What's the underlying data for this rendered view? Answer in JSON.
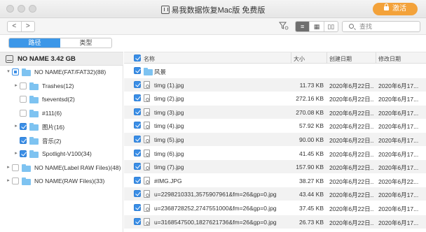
{
  "window": {
    "title": "易我数据恢复Mac版 免费版",
    "activate_label": "激活"
  },
  "toolbar": {
    "back": "<",
    "forward": ">",
    "filter_icon": "filter-icon",
    "view_modes": [
      "≡",
      "▦",
      "▯▯"
    ],
    "search_placeholder": "查找"
  },
  "left_tabs": {
    "path_label": "路径",
    "type_label": "类型",
    "selected": "路径"
  },
  "drive": {
    "label": "NO NAME 3.42 GB"
  },
  "tree": [
    {
      "label": "NO NAME(FAT/FAT32)(88)",
      "state": "mixed",
      "arrow": "▾",
      "depth": 0
    },
    {
      "label": "Trashes(12)",
      "state": "unchecked",
      "arrow": "▸",
      "depth": 1
    },
    {
      "label": "fseventsd(2)",
      "state": "unchecked",
      "arrow": "",
      "depth": 1
    },
    {
      "label": "#111(6)",
      "state": "unchecked",
      "arrow": "",
      "depth": 1
    },
    {
      "label": "图片(16)",
      "state": "checked",
      "arrow": "▸",
      "depth": 1
    },
    {
      "label": "音乐(2)",
      "state": "checked",
      "arrow": "",
      "depth": 1
    },
    {
      "label": "Spotlight-V100(34)",
      "state": "checked",
      "arrow": "▸",
      "depth": 1
    },
    {
      "label": "NO NAME(Label RAW Files)(48)",
      "state": "unchecked",
      "arrow": "▸",
      "depth": 0
    },
    {
      "label": "NO NAME(RAW Files)(33)",
      "state": "unchecked",
      "arrow": "▸",
      "depth": 0
    }
  ],
  "table": {
    "columns": [
      "名称",
      "大小",
      "创建日期",
      "修改日期"
    ],
    "rows": [
      {
        "name": "风景",
        "size": "",
        "created": "",
        "modified": "",
        "type": "folder"
      },
      {
        "name": "timg (1).jpg",
        "size": "11.73 KB",
        "created": "2020年6月22日...",
        "modified": "2020年6月17...",
        "type": "file"
      },
      {
        "name": "timg (2).jpg",
        "size": "272.16 KB",
        "created": "2020年6月22日...",
        "modified": "2020年6月17...",
        "type": "file"
      },
      {
        "name": "timg (3).jpg",
        "size": "270.08 KB",
        "created": "2020年6月22日...",
        "modified": "2020年6月17...",
        "type": "file"
      },
      {
        "name": "timg (4).jpg",
        "size": "57.92 KB",
        "created": "2020年6月22日...",
        "modified": "2020年6月17...",
        "type": "file"
      },
      {
        "name": "timg (5).jpg",
        "size": "90.00 KB",
        "created": "2020年6月22日...",
        "modified": "2020年6月17...",
        "type": "file"
      },
      {
        "name": "timg (6).jpg",
        "size": "41.45 KB",
        "created": "2020年6月22日...",
        "modified": "2020年6月17...",
        "type": "file"
      },
      {
        "name": "timg (7).jpg",
        "size": "157.90 KB",
        "created": "2020年6月22日...",
        "modified": "2020年6月17...",
        "type": "file"
      },
      {
        "name": "#IMG.JPG",
        "size": "38.27 KB",
        "created": "2020年6月22日...",
        "modified": "2020年6月22...",
        "type": "file"
      },
      {
        "name": "u=2298210331,3575907961&fm=26&gp=0.jpg",
        "size": "43.44 KB",
        "created": "2020年6月22日...",
        "modified": "2020年6月17...",
        "type": "file"
      },
      {
        "name": "u=2368728252,2747551000&fm=26&gp=0.jpg",
        "size": "37.45 KB",
        "created": "2020年6月22日...",
        "modified": "2020年6月17...",
        "type": "file"
      },
      {
        "name": "u=3168547500,1827621736&fm=26&gp=0.jpg",
        "size": "26.73 KB",
        "created": "2020年6月22日...",
        "modified": "2020年6月17...",
        "type": "file"
      }
    ]
  },
  "colors": {
    "accent": "#3c97e8",
    "activate": "#f3a23a",
    "folder": "#7ec3f1"
  }
}
